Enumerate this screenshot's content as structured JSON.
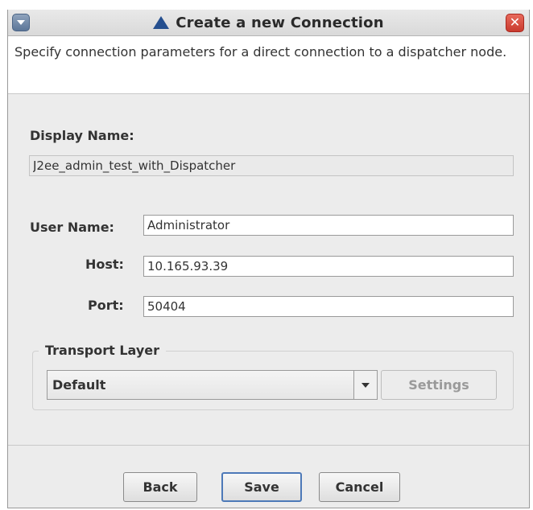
{
  "window": {
    "title": "Create a new Connection",
    "menu_icon": "chevron-down-icon",
    "close_label": "✕"
  },
  "info": {
    "text": "Specify connection parameters for a direct connection to a dispatcher node."
  },
  "display_name": {
    "label": "Display Name:",
    "value": "J2ee_admin_test_with_Dispatcher"
  },
  "user_name": {
    "label": "User Name:",
    "value": "Administrator"
  },
  "host": {
    "label": "Host:",
    "value": "10.165.93.39"
  },
  "port": {
    "label": "Port:",
    "value": "50404"
  },
  "transport": {
    "group_label": "Transport Layer",
    "selected": "Default",
    "settings_label": "Settings"
  },
  "buttons": {
    "back": "Back",
    "save": "Save",
    "cancel": "Cancel"
  }
}
